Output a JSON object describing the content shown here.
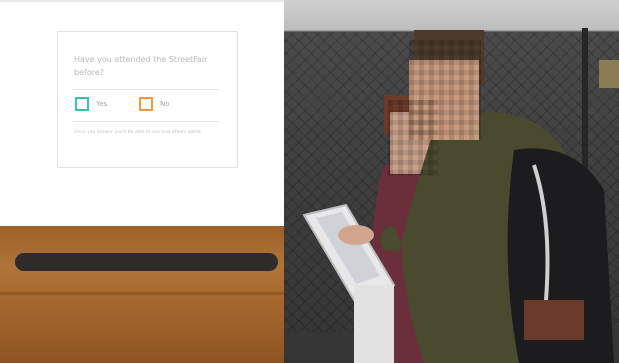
{
  "survey": {
    "question": "Have you attended the StreetFair before?",
    "options": [
      {
        "label": "Yes",
        "color": "#38c0b4"
      },
      {
        "label": "No",
        "color": "#f4953f"
      }
    ],
    "note": "Once you answer you'll be able to see how others voted."
  },
  "colors": {
    "yes_accent": "#38c0b4",
    "no_accent": "#f4953f",
    "wood": "#a8692e",
    "slot": "#2e2b2a"
  }
}
